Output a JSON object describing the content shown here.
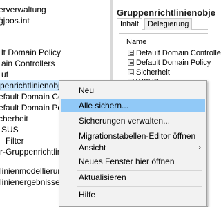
{
  "tree": {
    "items": [
      {
        "label": "erverwaltung",
        "icon": "gpo-icon"
      },
      {
        "label": "ġjoos.int",
        "icon": "none"
      },
      {
        "label": "",
        "icon": "none"
      },
      {
        "label": "lt Domain Policy",
        "icon": "none"
      },
      {
        "label": "ain Controllers",
        "icon": "none"
      },
      {
        "label": "uf",
        "icon": "none"
      },
      {
        "label": "penrichtlinienobjekte",
        "icon": "none",
        "selected": true
      },
      {
        "label": "efault Domain Contr",
        "icon": "none"
      },
      {
        "label": "efault Domain Polic",
        "icon": "none"
      },
      {
        "label": "cherheit",
        "icon": "none"
      },
      {
        "label": "SUS",
        "icon": "none"
      },
      {
        "label": "Filter",
        "icon": "none"
      },
      {
        "label": "r-Gruppenrichtlinie",
        "icon": "none"
      },
      {
        "label": "",
        "icon": "none"
      },
      {
        "label": "linienmodellierung",
        "icon": "none"
      },
      {
        "label": "linienergebnisse",
        "icon": "none"
      }
    ]
  },
  "right": {
    "title": "Gruppenrichtlinienobje",
    "tabs": [
      {
        "label": "Inhalt",
        "active": true
      },
      {
        "label": "Delegierung",
        "active": false
      }
    ],
    "list_header": "Name",
    "items": [
      {
        "label": "Default Domain Controllers"
      },
      {
        "label": "Default Domain Policy"
      },
      {
        "label": "Sicherheit"
      },
      {
        "label": "WSUS"
      }
    ]
  },
  "menu": {
    "items": [
      {
        "label": "Neu"
      },
      {
        "label": "Alle sichern...",
        "highlighted": true
      },
      {
        "label": "Sicherungen verwalten..."
      },
      {
        "label": "Migrationstabellen-Editor öffnen"
      },
      {
        "label": "Ansicht",
        "submenu": true
      },
      {
        "label": "Neues Fenster hier öffnen"
      },
      {
        "label": "Aktualisieren"
      },
      {
        "label": "Hilfe"
      }
    ],
    "submenu_glyph": "›"
  }
}
